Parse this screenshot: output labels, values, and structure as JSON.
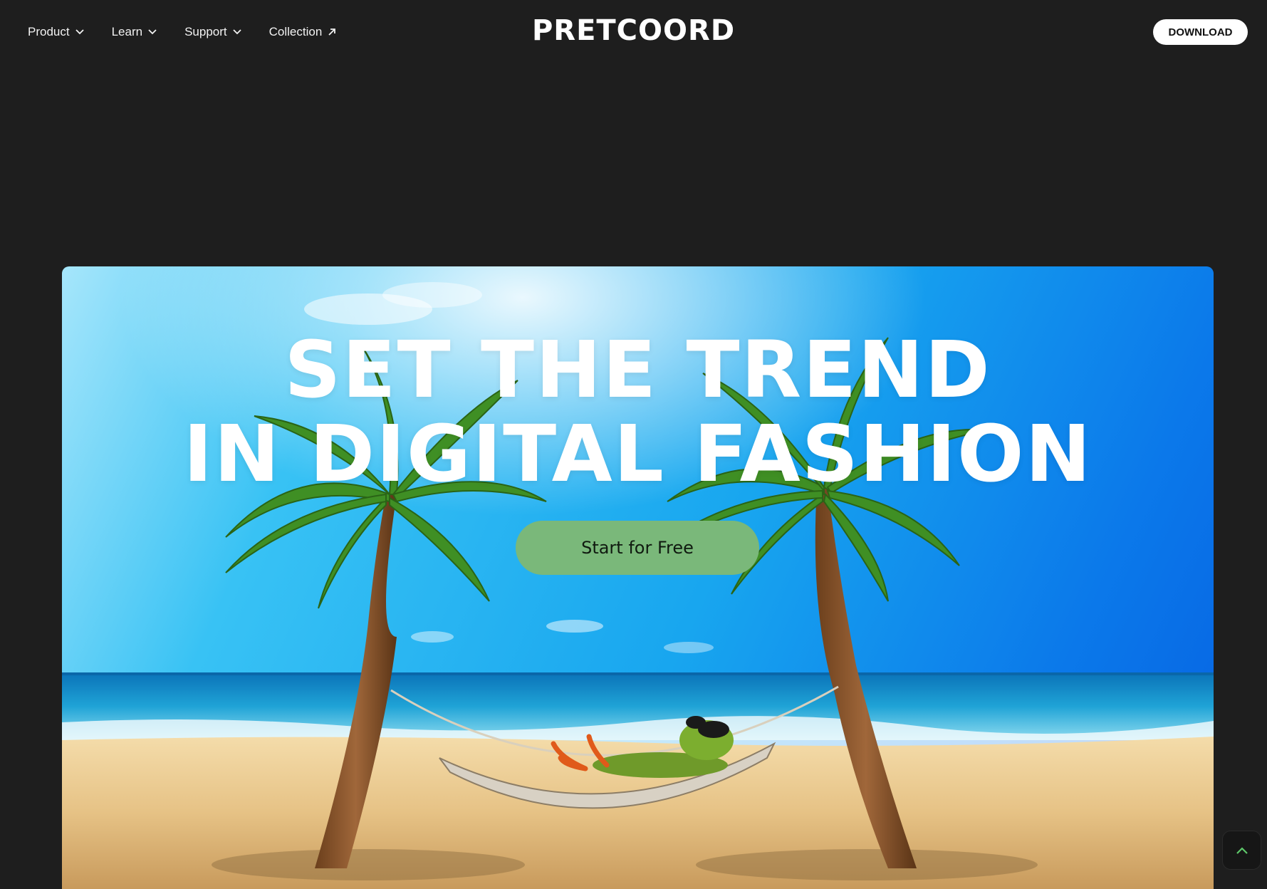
{
  "nav": {
    "items": [
      {
        "label": "Product",
        "icon": "chevron-down-icon"
      },
      {
        "label": "Learn",
        "icon": "chevron-down-icon"
      },
      {
        "label": "Support",
        "icon": "chevron-down-icon"
      },
      {
        "label": "Collection",
        "icon": "arrow-up-right-icon"
      }
    ]
  },
  "brand": {
    "name": "PRETCOORD"
  },
  "header": {
    "download_label": "DOWNLOAD"
  },
  "hero": {
    "headline_line1": "SET THE TREND",
    "headline_line2": "IN DIGITAL FASHION",
    "cta_label": "Start for Free",
    "image": "tropical-beach-palms-hammock-frog"
  },
  "scroll_top": {
    "icon": "chevron-up-icon"
  },
  "colors": {
    "background": "#1e1e1e",
    "cta": "#7ab87a",
    "scroll_top_arrow": "#5ec86a"
  }
}
